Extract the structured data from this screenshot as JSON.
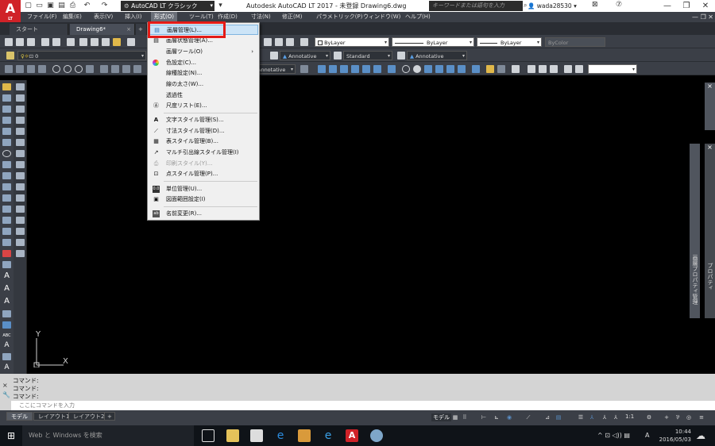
{
  "titlebar": {
    "workspace": "AutoCAD LT クラシック",
    "doc_title": "Autodesk AutoCAD LT 2017 - 未登録    Drawing6.dwg",
    "search_placeholder": "キーワードまたは語句を入力",
    "user": "wada28530"
  },
  "menubar": {
    "items": [
      "ファイル(F)",
      "編集(E)",
      "表示(V)",
      "挿入(I)",
      "形式(O)",
      "ツール(T)",
      "作成(D)",
      "寸法(N)",
      "修正(M)",
      "パラメトリック(P)",
      "ウィンドウ(W)",
      "ヘルプ(H)"
    ]
  },
  "tabs": {
    "start": "スタート",
    "drawing": "Drawing6*"
  },
  "toolbar": {
    "layer_name": "0",
    "color_bylayer": "ByLayer",
    "linetype_bylayer": "ByLayer",
    "lineweight_bylayer": "ByLayer",
    "plotstyle_bycolor": "ByColor",
    "textstyle": "Annotative",
    "dimstyle": "Standard",
    "mleaderstyle": "Annotative",
    "tablestyle": "Annotative"
  },
  "dropdown": {
    "items": [
      {
        "label": "画層管理(L)...",
        "icon": "layer-manager-icon"
      },
      {
        "label": "画層状態管理(A)...",
        "icon": "layer-states-icon"
      },
      {
        "label": "画層ツール(O)",
        "icon": "",
        "submenu": true
      },
      {
        "label": "色設定(C)...",
        "icon": "color-wheel-icon"
      },
      {
        "label": "線種設定(N)...",
        "icon": ""
      },
      {
        "label": "線の太さ(W)...",
        "icon": ""
      },
      {
        "label": "透過性",
        "icon": ""
      },
      {
        "label": "尺度リスト(E)...",
        "icon": "scale-list-icon"
      },
      {
        "label": "文字スタイル管理(S)...",
        "icon": "text-style-icon"
      },
      {
        "label": "寸法スタイル管理(D)...",
        "icon": "dim-style-icon"
      },
      {
        "label": "表スタイル管理(B)...",
        "icon": "table-style-icon"
      },
      {
        "label": "マルチ引出線スタイル管理(I)",
        "icon": "mleader-style-icon"
      },
      {
        "label": "印刷スタイル(Y)...",
        "icon": "plot-style-icon",
        "disabled": true
      },
      {
        "label": "点スタイル管理(P)...",
        "icon": "point-style-icon"
      },
      {
        "label": "単位管理(U)...",
        "icon": "units-icon"
      },
      {
        "label": "図面範囲設定(I)",
        "icon": "limits-icon"
      },
      {
        "label": "名前変更(R)...",
        "icon": "rename-icon"
      }
    ]
  },
  "command": {
    "lines": [
      "コマンド:",
      "コマンド:",
      "コマンド:"
    ],
    "input_placeholder": "ここにコマンドを入力"
  },
  "layout_tabs": [
    "モデル",
    "レイアウト1",
    "レイアウト2"
  ],
  "statusbar": {
    "model_label": "モデル",
    "scale": "1:1"
  },
  "taskbar": {
    "search": "Web と Windows を検索",
    "time": "10:44",
    "date": "2016/05/03",
    "ime": "A"
  },
  "ucs": {
    "x": "X",
    "y": "Y"
  },
  "right_panel": {
    "layers": "画層プロパティ管理",
    "properties": "プロパティ"
  }
}
